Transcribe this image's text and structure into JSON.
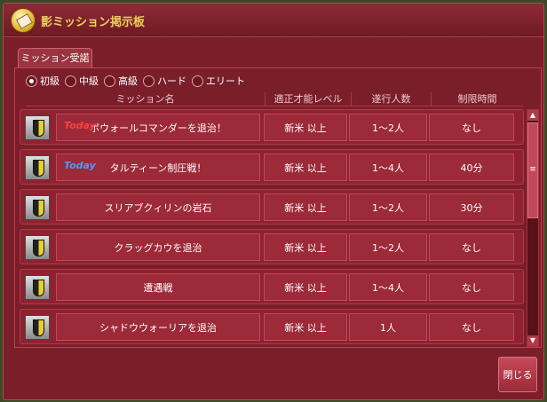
{
  "window": {
    "title": "影ミッション掲示板",
    "close_label": "閉じる"
  },
  "tab": {
    "label": "ミッション受諾"
  },
  "filters": [
    {
      "label": "初級",
      "checked": true
    },
    {
      "label": "中級",
      "checked": false
    },
    {
      "label": "高級",
      "checked": false
    },
    {
      "label": "ハード",
      "checked": false
    },
    {
      "label": "エリート",
      "checked": false
    }
  ],
  "columns": [
    "ミッション名",
    "適正才能レベル",
    "遂行人数",
    "制限時間"
  ],
  "colors": {
    "today_red": "#ff4040",
    "today_blue": "#40a0ff",
    "title_gold": "#f0d060"
  },
  "missions": [
    {
      "badge": "Today",
      "badge_color": "red",
      "name": "ボウォールコマンダーを退治！",
      "level": "新米 以上",
      "players": "1～2人",
      "time": "なし"
    },
    {
      "badge": "Today",
      "badge_color": "blue",
      "name": "タルティーン制圧戦！",
      "level": "新米 以上",
      "players": "1～4人",
      "time": "40分"
    },
    {
      "badge": "",
      "badge_color": "",
      "name": "スリアブクィリンの岩石",
      "level": "新米 以上",
      "players": "1～2人",
      "time": "30分"
    },
    {
      "badge": "",
      "badge_color": "",
      "name": "クラッグカウを退治",
      "level": "新米 以上",
      "players": "1～2人",
      "time": "なし"
    },
    {
      "badge": "",
      "badge_color": "",
      "name": "遭遇戦",
      "level": "新米 以上",
      "players": "1～4人",
      "time": "なし"
    },
    {
      "badge": "",
      "badge_color": "",
      "name": "シャドウウォーリアを退治",
      "level": "新米 以上",
      "players": "1人",
      "time": "なし"
    }
  ]
}
